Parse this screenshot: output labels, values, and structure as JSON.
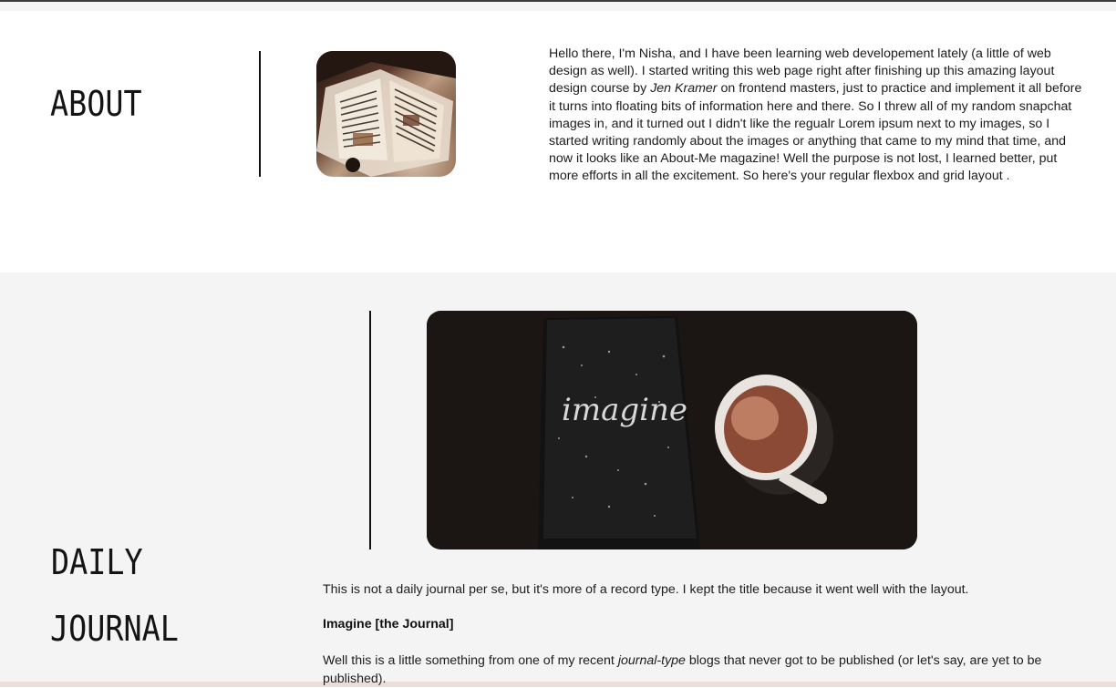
{
  "about": {
    "title": "ABOUT",
    "text_part1": "Hello there, I'm Nisha, and I have been learning web developement lately (a little of web design as well). I started writing this web page right after finishing up this amazing layout design course by ",
    "author": "Jen Kramer",
    "text_part2": " on frontend masters, just to practice and implement it all before it turns into floating bits of information here and there. So I threw all of my random snapchat images in, and it turned out I didn't like the regualr Lorem ipsum next to my images, so I started writing randomly about the images or anything that came to my mind that time, and now it looks like an About-Me magazine! Well the purpose is not lost, I learned better, put more efforts in all the excitement. So here's your regular flexbox and grid layout ."
  },
  "journal": {
    "title_line1": "DAILY",
    "title_line2": "JOURNAL",
    "photo_text": "imagine",
    "intro": "This is not a daily journal per se, but it's more of a record type. I kept the title because it went well with the layout.",
    "subheading": "Imagine [the Journal]",
    "blog_part1": "Well this is a little something from one of my recent ",
    "blog_emph": "journal-type",
    "blog_part2": " blogs that never got to be published (or let's say, are yet to be published)."
  },
  "colors": {
    "page_bg": "#ffffff",
    "journal_bg": "#f4f4f4",
    "text": "#1c1c1c"
  }
}
